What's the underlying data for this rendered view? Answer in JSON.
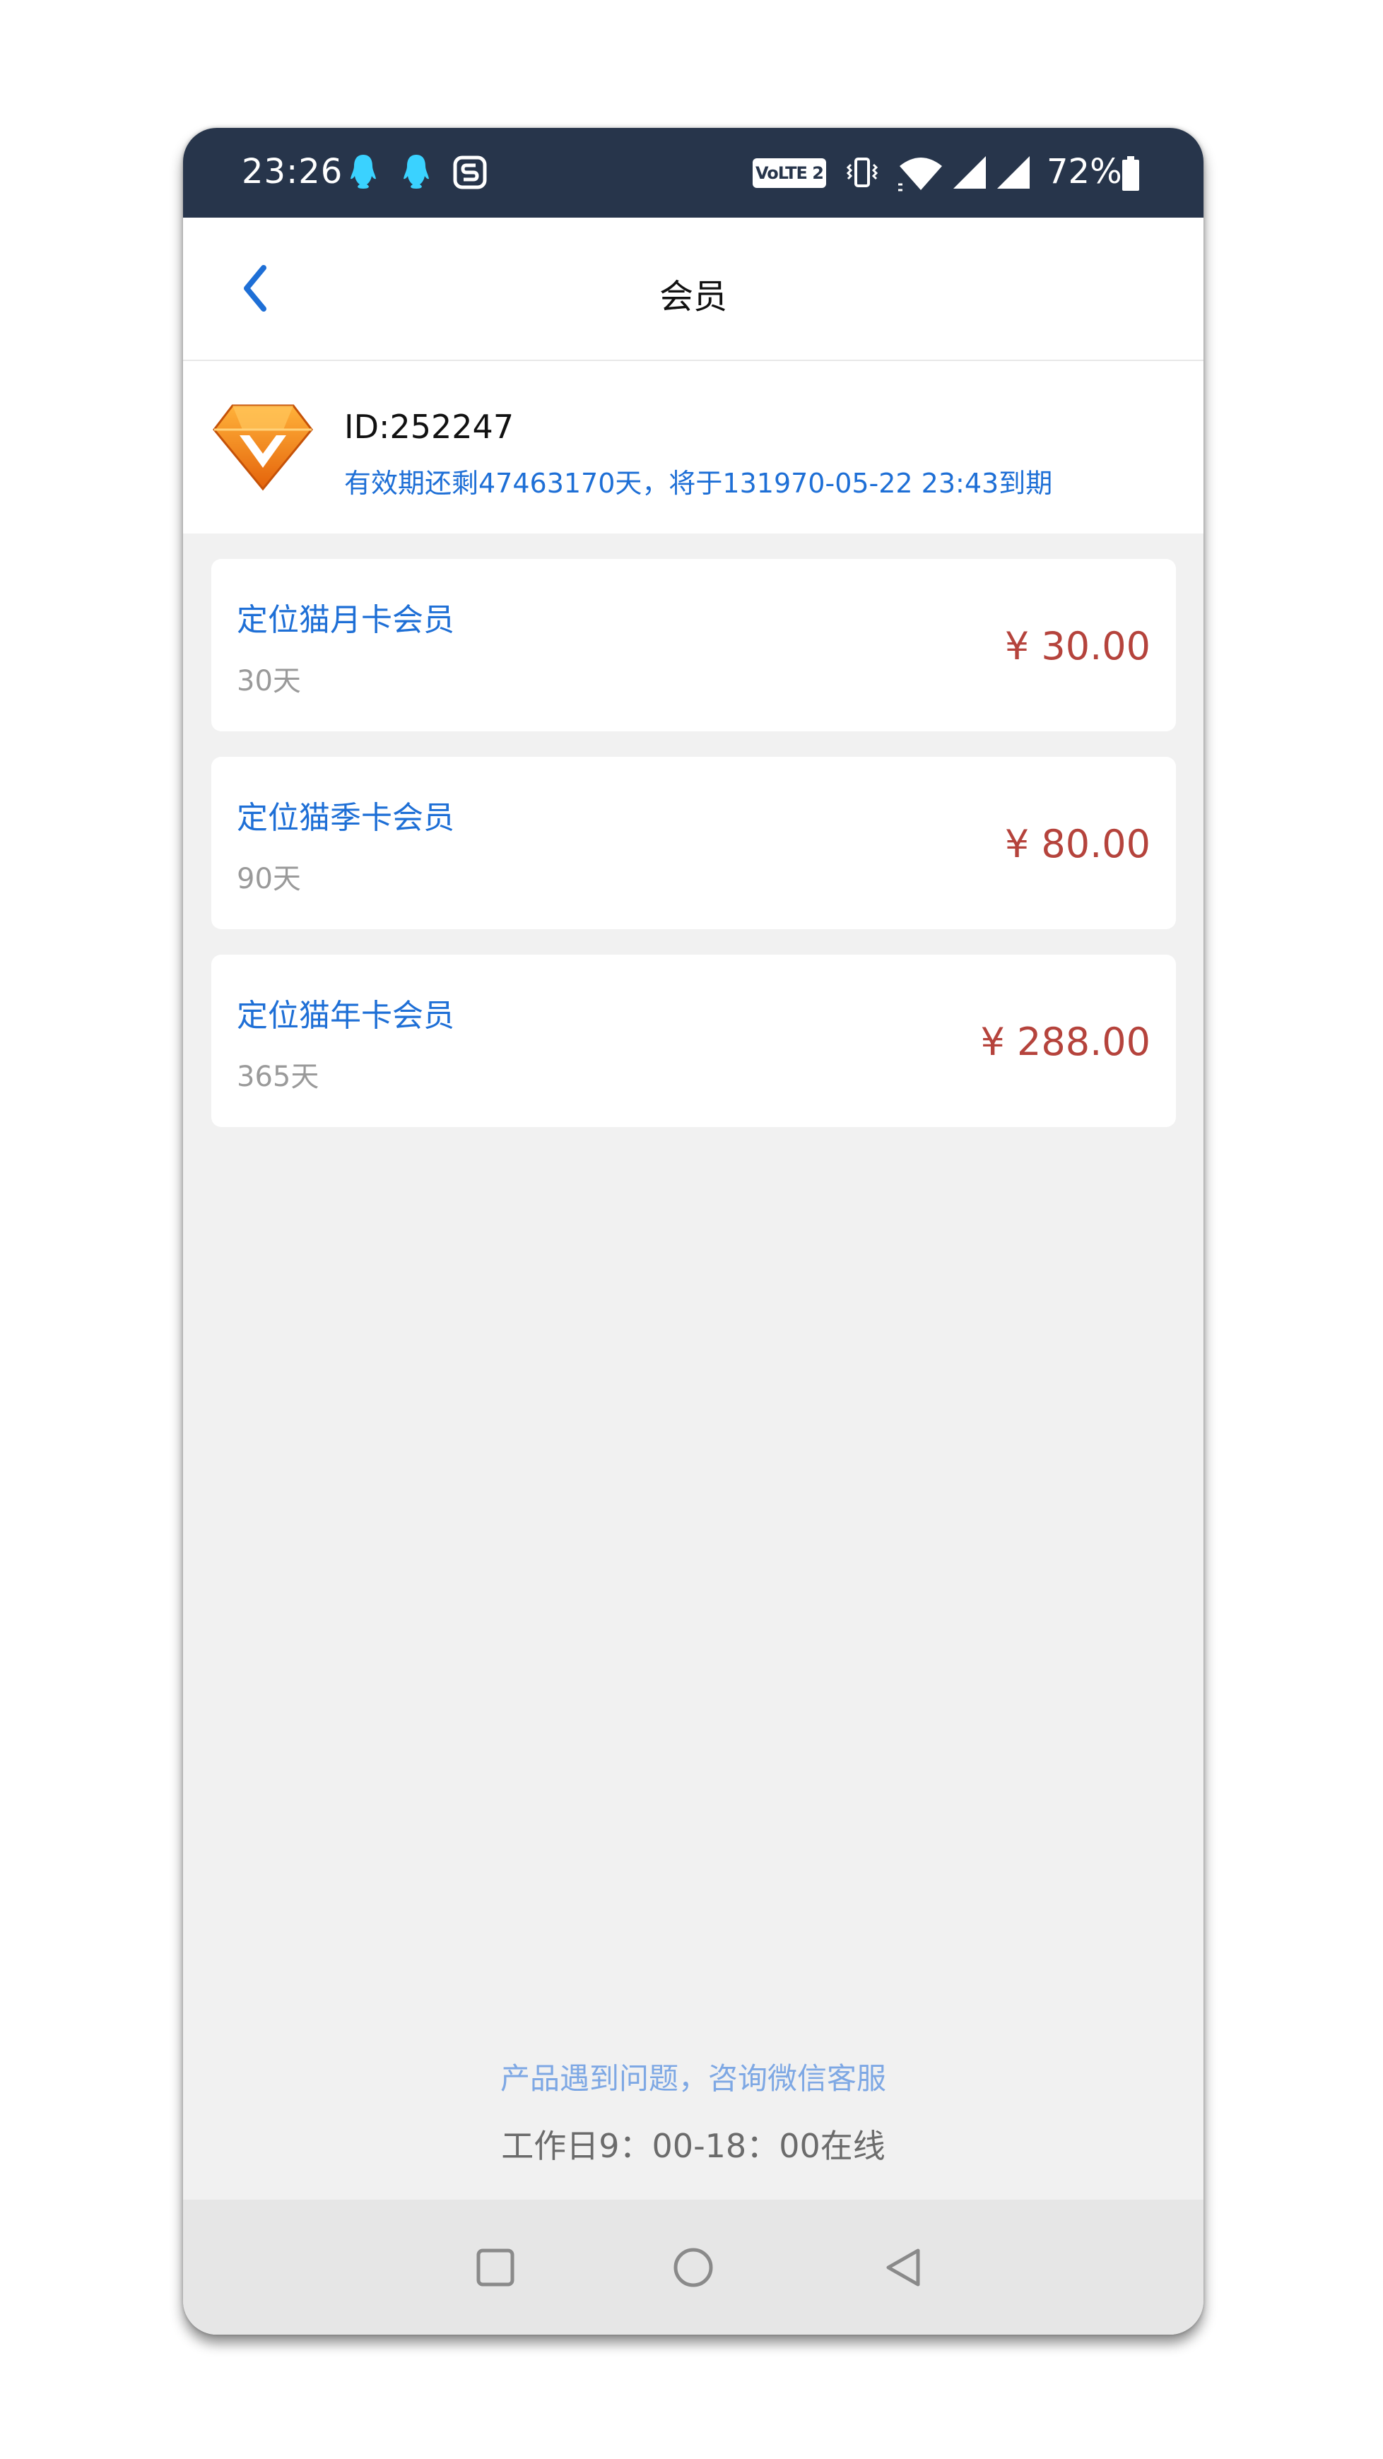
{
  "status_bar": {
    "time": "23:26",
    "volte_label": "VoLTE 2",
    "battery_percent": "72%",
    "background_color": "#27354b",
    "notification_icons": [
      "qq-icon",
      "qq-icon",
      "sogou-icon"
    ],
    "system_icons": [
      "vibrate-icon",
      "wifi-icon",
      "signal-icon",
      "signal-icon",
      "battery-icon"
    ]
  },
  "header": {
    "title": "会员",
    "back_icon": "chevron-left-icon",
    "back_color": "#1e6fd6"
  },
  "user": {
    "badge_icon": "vip-diamond-icon",
    "id_text": "ID:252247",
    "expiry_text": "有效期还剩47463170天，将于131970-05-22 23:43到期"
  },
  "plans": [
    {
      "name": "定位猫月卡会员",
      "duration": "30天",
      "price": "¥ 30.00"
    },
    {
      "name": "定位猫季卡会员",
      "duration": "90天",
      "price": "¥ 80.00"
    },
    {
      "name": "定位猫年卡会员",
      "duration": "365天",
      "price": "¥ 288.00"
    }
  ],
  "footer": {
    "support_text": "产品遇到问题，咨询微信客服",
    "hours_text": "工作日9：00-18：00在线"
  },
  "system_nav": {
    "buttons": [
      "recents-square-icon",
      "home-circle-icon",
      "back-triangle-icon"
    ]
  },
  "colors": {
    "accent_blue": "#1e6fd6",
    "price_red": "#b5433c",
    "page_background": "#f1f1f1"
  }
}
